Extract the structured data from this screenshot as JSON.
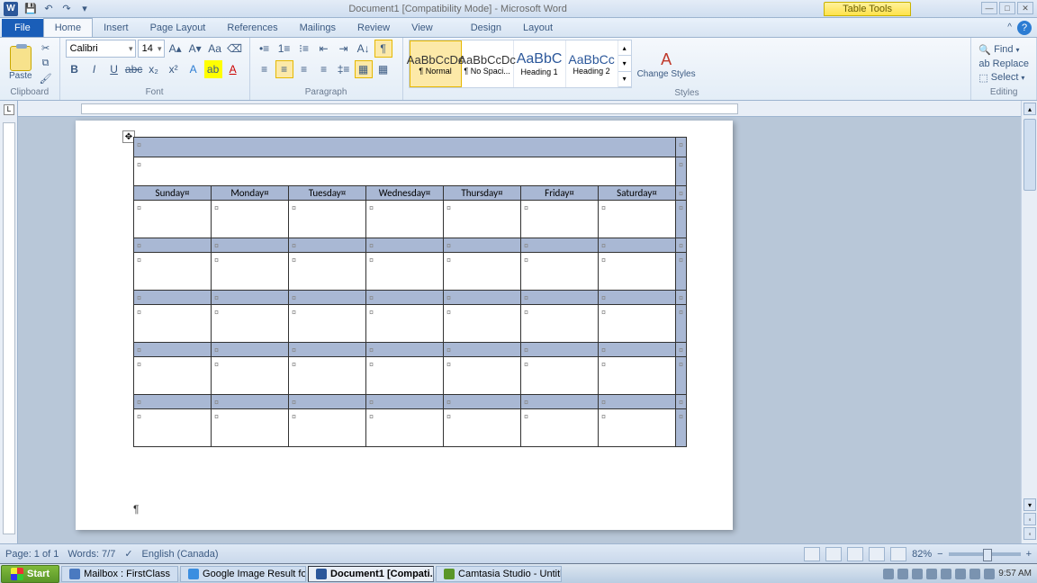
{
  "title": "Document1 [Compatibility Mode] - Microsoft Word",
  "table_tools": "Table Tools",
  "tabs": {
    "file": "File",
    "home": "Home",
    "insert": "Insert",
    "page_layout": "Page Layout",
    "references": "References",
    "mailings": "Mailings",
    "review": "Review",
    "view": "View",
    "design": "Design",
    "layout": "Layout"
  },
  "ribbon": {
    "clipboard": {
      "label": "Clipboard",
      "paste": "Paste"
    },
    "font": {
      "label": "Font",
      "name": "Calibri",
      "size": "14"
    },
    "paragraph": {
      "label": "Paragraph"
    },
    "styles": {
      "label": "Styles",
      "items": [
        {
          "preview": "AaBbCcDc",
          "name": "¶ Normal"
        },
        {
          "preview": "AaBbCcDc",
          "name": "¶ No Spaci..."
        },
        {
          "preview": "AaBbC",
          "name": "Heading 1"
        },
        {
          "preview": "AaBbCc",
          "name": "Heading 2"
        }
      ],
      "change": "Change Styles"
    },
    "editing": {
      "label": "Editing",
      "find": "Find",
      "replace": "Replace",
      "select": "Select"
    }
  },
  "calendar": {
    "days": [
      "Sunday¤",
      "Monday¤",
      "Tuesday¤",
      "Wednesday¤",
      "Thursday¤",
      "Friday¤",
      "Saturday¤"
    ]
  },
  "status": {
    "page": "Page: 1 of 1",
    "words": "Words: 7/7",
    "lang": "English (Canada)",
    "zoom": "82%"
  },
  "taskbar": {
    "start": "Start",
    "items": [
      "Mailbox : FirstClass",
      "Google Image Result for ...",
      "Document1 [Compati...",
      "Camtasia Studio - Untitle..."
    ],
    "time": "9:57 AM"
  }
}
